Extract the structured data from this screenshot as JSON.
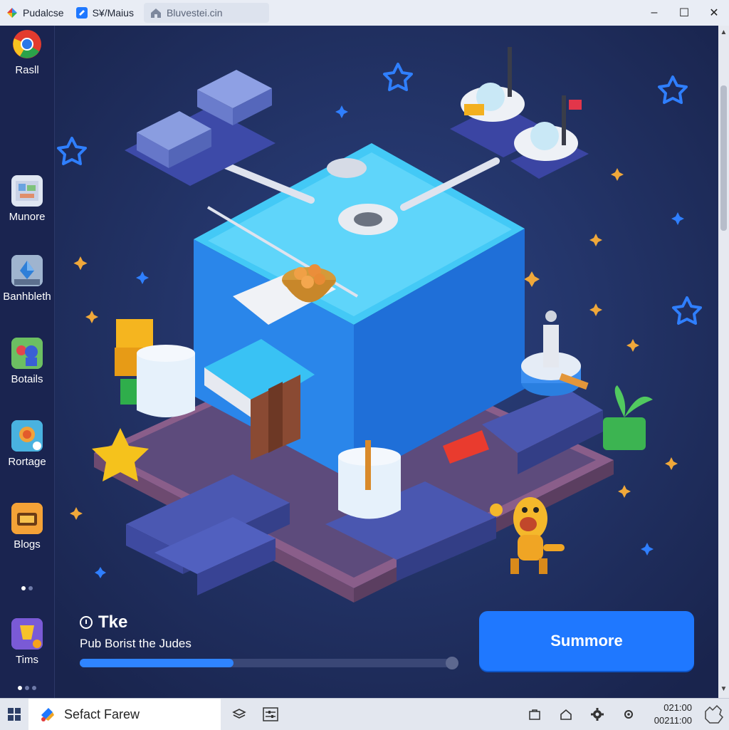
{
  "titlebar": {
    "tabs": [
      {
        "label": "Pudalcse",
        "icon": "multicolor-logo-icon"
      },
      {
        "label": "S¥/Maius",
        "icon": "blue-app-icon"
      },
      {
        "label": "Bluvestei.cin",
        "icon": "home-icon"
      }
    ],
    "controls": {
      "minimize": "–",
      "maximize": "☐",
      "close": "✕"
    }
  },
  "sidebar": {
    "items": [
      {
        "label": "Rasll",
        "icon": "chrome-icon"
      },
      {
        "label": "Munore",
        "icon": "app-tile-icon"
      },
      {
        "label": "Banhbleth",
        "icon": "crystal-game-icon"
      },
      {
        "label": "Botails",
        "icon": "characters-game-icon"
      },
      {
        "label": "Rortage",
        "icon": "rortage-game-icon"
      },
      {
        "label": "Blogs",
        "icon": "box-game-icon"
      },
      {
        "label": "Tims",
        "icon": "tims-game-icon"
      }
    ]
  },
  "game": {
    "title": "Tke",
    "subtitle": "Pub Borist the Judes",
    "progress": 0.41,
    "cta_label": "Summore"
  },
  "taskbar": {
    "search_text": "Sefact Farew",
    "clock_line1": "021:00",
    "clock_line2": "00211:00"
  },
  "colors": {
    "accent": "#1f78ff",
    "background": "#1c2a55",
    "cube": "#2f8cf0"
  }
}
